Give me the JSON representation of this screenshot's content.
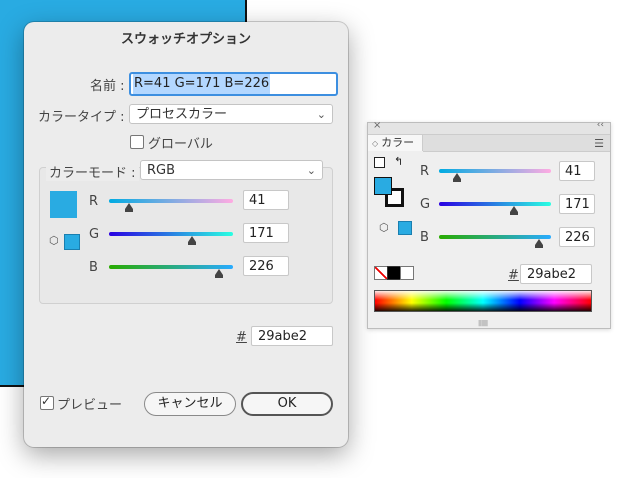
{
  "dialog": {
    "title": "スウォッチオプション",
    "name_label": "名前 :",
    "name_value": "R=41 G=171 B=226",
    "color_type_label": "カラータイプ :",
    "color_type_value": "プロセスカラー",
    "global_label": "グローバル",
    "color_mode_label": "カラーモード :",
    "color_mode_value": "RGB",
    "channels": [
      {
        "label": "R",
        "value": "41",
        "fraction": 0.16
      },
      {
        "label": "G",
        "value": "171",
        "fraction": 0.67
      },
      {
        "label": "B",
        "value": "226",
        "fraction": 0.89
      }
    ],
    "hash_label": "#",
    "hex_value": "29abe2",
    "preview_label": "プレビュー",
    "cancel_label": "キャンセル",
    "ok_label": "OK"
  },
  "panel": {
    "tab_label": "カラー",
    "channels": [
      {
        "label": "R",
        "value": "41",
        "fraction": 0.16
      },
      {
        "label": "G",
        "value": "171",
        "fraction": 0.67
      },
      {
        "label": "B",
        "value": "226",
        "fraction": 0.89
      }
    ],
    "hash_label": "#",
    "hex_value": "29abe2"
  },
  "colors": {
    "swatch": "#29abe2"
  }
}
